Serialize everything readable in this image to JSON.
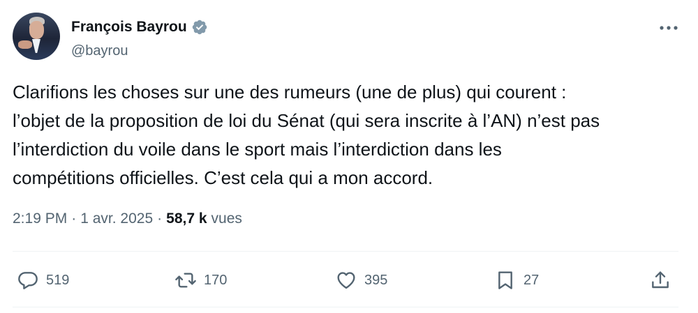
{
  "author": {
    "display_name": "François Bayrou",
    "handle": "@bayrou",
    "verified": true
  },
  "tweet": {
    "text": "Clarifions les choses sur une des rumeurs (une de plus) qui courent :\nl’objet de la proposition de loi du Sénat (qui sera inscrite à l’AN) n’est pas\nl’interdiction du voile dans le sport mais l’interdiction dans les\ncompétitions officielles. C’est cela qui a mon accord.",
    "time": "2:19 PM",
    "separator": "·",
    "date": "1 avr. 2025",
    "views_count": "58,7 k",
    "views_label": "vues"
  },
  "actions": {
    "replies": "519",
    "reposts": "170",
    "likes": "395",
    "bookmarks": "27"
  },
  "icons": {
    "verified": "verified-badge-icon",
    "more": "more-horizontal-icon",
    "reply": "reply-bubble-icon",
    "repost": "repost-arrows-icon",
    "like": "heart-icon",
    "bookmark": "bookmark-icon",
    "share": "share-upload-icon"
  },
  "colors": {
    "verified": "#829aab",
    "text_primary": "#0f1419",
    "text_secondary": "#536471",
    "divider": "#eff3f4"
  }
}
